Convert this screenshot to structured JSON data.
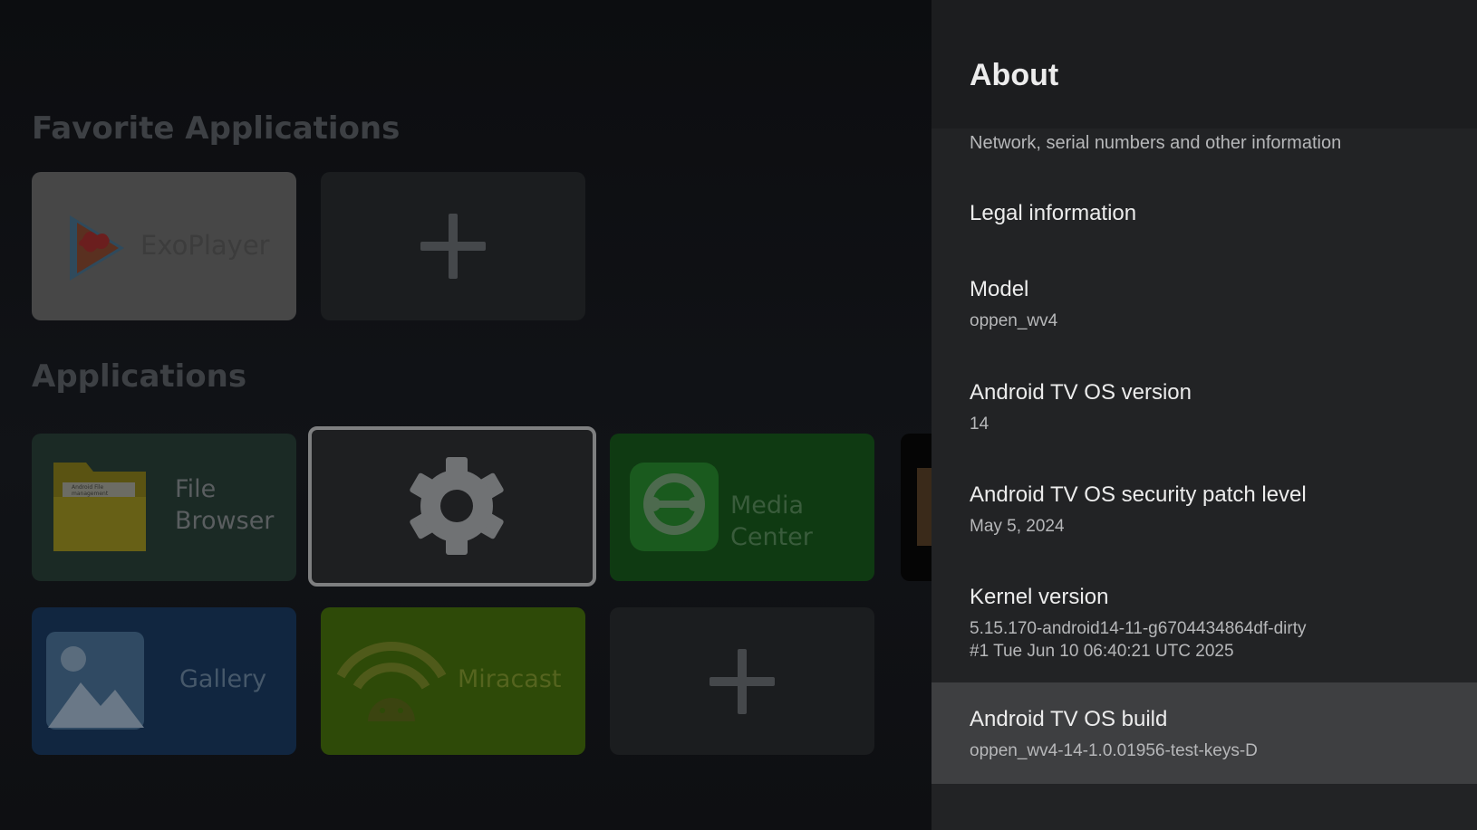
{
  "launcher": {
    "favorites_title": "Favorite Applications",
    "applications_title": "Applications",
    "favorites": [
      {
        "label": "ExoPlayer",
        "icon": "exoplayer-icon"
      },
      {
        "label": "",
        "icon": "plus-icon"
      }
    ],
    "apps": [
      {
        "label": "File Browser",
        "icon": "folder-icon",
        "folder_text": "Android File management"
      },
      {
        "label": "",
        "icon": "gear-icon"
      },
      {
        "label": "Media Center",
        "icon": "media-center-icon"
      },
      {
        "label": "Gallery",
        "icon": "gallery-icon"
      },
      {
        "label": "Miracast",
        "icon": "miracast-icon"
      },
      {
        "label": "",
        "icon": "plus-icon"
      }
    ]
  },
  "panel": {
    "title": "About",
    "items": [
      {
        "title": "",
        "summary": "Network, serial numbers and other information"
      },
      {
        "title": "Legal information",
        "summary": ""
      },
      {
        "title": "Model",
        "summary": "oppen_wv4"
      },
      {
        "title": "Android TV OS version",
        "summary": "14"
      },
      {
        "title": "Android TV OS security patch level",
        "summary": "May 5, 2024"
      },
      {
        "title": "Kernel version",
        "summary": "5.15.170-android14-11-g6704434864df-dirty",
        "summary2": "#1 Tue Jun 10 06:40:21 UTC 2025"
      },
      {
        "title": "Android TV OS build",
        "summary": "oppen_wv4-14-1.0.01956-test-keys-D",
        "focused": true
      }
    ]
  },
  "colors": {
    "panel_bg": "#222325",
    "panel_header_bg": "#1c1d1f",
    "focused_row_bg": "#3e3f41",
    "file_browser_tile": "#1b2a25",
    "media_center_tile": "#0f3a12",
    "gallery_tile": "#112640",
    "miracast_tile": "#2e4a08"
  }
}
